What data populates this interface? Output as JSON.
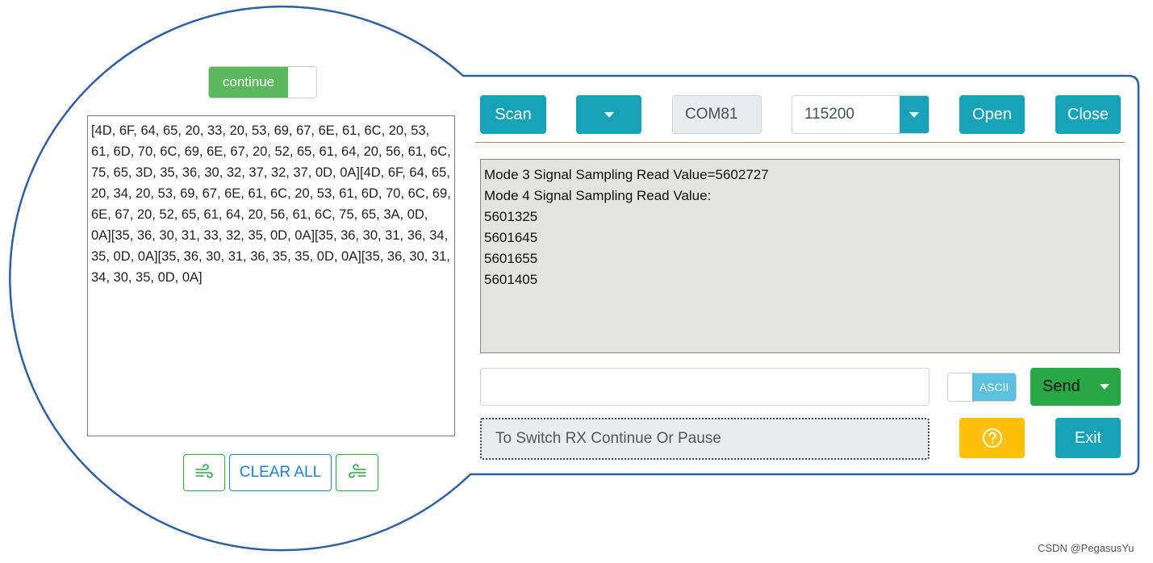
{
  "left_panel": {
    "rx_toggle_label": "continue",
    "hex_output": "[4D, 6F, 64, 65, 20, 33, 20, 53, 69, 67, 6E, 61, 6C, 20, 53, 61, 6D, 70, 6C, 69, 6E, 67, 20, 52, 65, 61, 64, 20, 56, 61, 6C, 75, 65, 3D, 35, 36, 30, 32, 37, 32, 37, 0D, 0A][4D, 6F, 64, 65, 20, 34, 20, 53, 69, 67, 6E, 61, 6C, 20, 53, 61, 6D, 70, 6C, 69, 6E, 67, 20, 52, 65, 61, 64, 20, 56, 61, 6C, 75, 65, 3A, 0D, 0A][35, 36, 30, 31, 33, 32, 35, 0D, 0A][35, 36, 30, 31, 36, 34, 35, 0D, 0A][35, 36, 30, 31, 36, 35, 35, 0D, 0A][35, 36, 30, 31, 34, 30, 35, 0D, 0A]",
    "clear_all_label": "CLEAR ALL",
    "left_icon": "wind-icon",
    "right_icon": "wind-icon"
  },
  "toolbar": {
    "scan_label": "Scan",
    "port_value": "COM81",
    "baud_value": "115200",
    "open_label": "Open",
    "close_label": "Close"
  },
  "rx_log": "Mode 3 Signal Sampling Read Value=5602727\nMode 4 Signal Sampling Read Value:\n5601325\n5601645\n5601655\n5601405",
  "tx": {
    "input_value": "",
    "ascii_label": "ASCII",
    "send_label": "Send"
  },
  "hint": "To Switch RX Continue Or Pause",
  "exit_label": "Exit",
  "watermark": "CSDN @PegasusYu",
  "colors": {
    "frame": "#2e5fa8",
    "teal": "#17a2b8",
    "green": "#28a745",
    "toggle_green": "#5cb85c",
    "ascii_blue": "#5bc0de",
    "yellow": "#ffc107",
    "divider": "#c9834a"
  }
}
